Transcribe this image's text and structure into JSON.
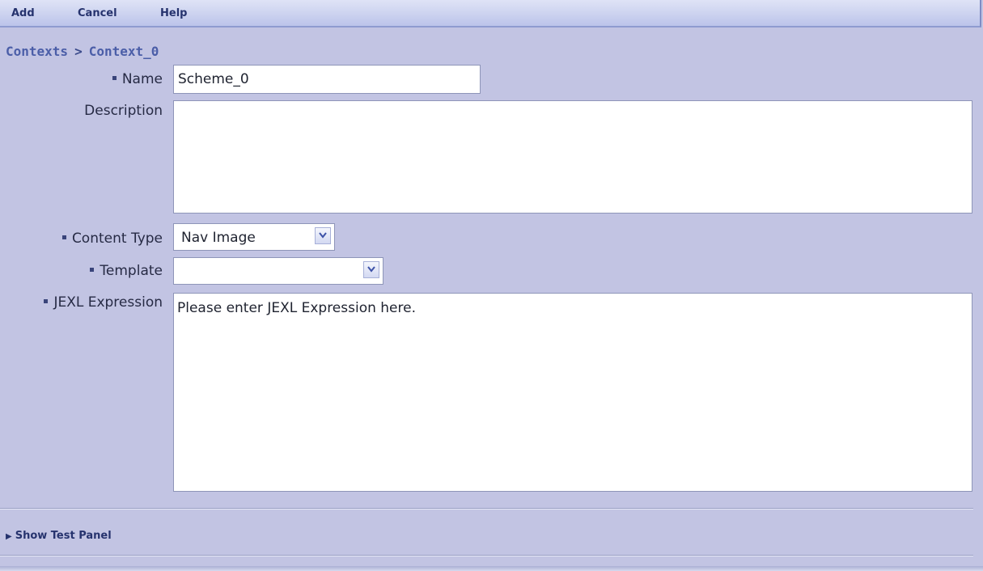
{
  "toolbar": {
    "add": "Add",
    "cancel": "Cancel",
    "help": "Help"
  },
  "breadcrumb": {
    "root": "Contexts",
    "separator": ">",
    "current": "Context_0"
  },
  "form": {
    "name": {
      "label": "Name",
      "value": "Scheme_0",
      "required": true
    },
    "description": {
      "label": "Description",
      "value": "",
      "required": false
    },
    "content_type": {
      "label": "Content Type",
      "selected": "Nav Image",
      "required": true
    },
    "template": {
      "label": "Template",
      "selected": "",
      "required": true
    },
    "jexl": {
      "label": "JEXL Expression",
      "value": "Please enter JEXL Expression here.",
      "required": true
    }
  },
  "test_panel": {
    "toggle_label": "Show Test Panel",
    "expanded": false
  },
  "colors": {
    "background": "#c2c4e3",
    "toolbar": "#c8cff0",
    "link": "#4b5ea8",
    "text": "#262a44"
  }
}
